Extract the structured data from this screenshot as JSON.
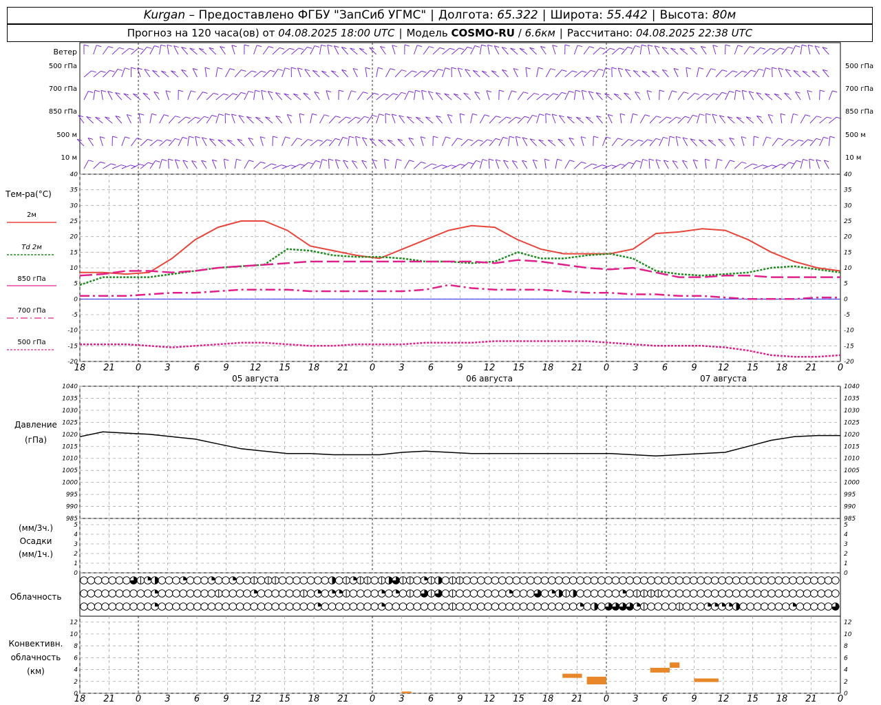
{
  "header": {
    "city": "Kurgan",
    "dash": "–",
    "provider": "Предоставлено ФГБУ \"ЗапСиб УГМС\"",
    "lon_label": "Долгота:",
    "lon": "65.322",
    "lat_label": "Широта:",
    "lat": "55.442",
    "alt_label": "Высота:",
    "alt": "80м",
    "forecast_label": "Прогноз на 120 часа(ов) от",
    "forecast_start": "04.08.2025 18:00 UTC",
    "model_label": "Модель",
    "model": "COSMO-RU",
    "model_res": "6.6км",
    "computed_label": "Рассчитано:",
    "computed": "04.08.2025 22:38 UTC"
  },
  "labels": {
    "wind": "Ветер",
    "wind_levels": [
      "500 гПа",
      "700 гПа",
      "850 гПа",
      "500 м",
      "10 м"
    ],
    "temp": "Тем-ра(°С)",
    "legend": [
      "2м",
      "Td 2м",
      "850 гПа",
      "700 гПа",
      "500 гПа"
    ],
    "pressure": [
      "Давление",
      "(гПа)"
    ],
    "precip": [
      "(мм/3ч.)",
      "Осадки",
      "(мм/1ч.)"
    ],
    "cloud": "Облачность",
    "conv": [
      "Конвективн.",
      "облачность",
      "(км)"
    ]
  },
  "colors": {
    "t2m": "#e8453a",
    "td": "#1e8c1e",
    "t850": "#e0208a",
    "t700": "#e0208a",
    "t500": "#e0208a",
    "wind": "#7b2fd0",
    "conv": "#e8862a",
    "zero": "#2424e0"
  },
  "time_ticks": [
    "18",
    "21",
    "0",
    "3",
    "6",
    "9",
    "12",
    "15",
    "18",
    "21",
    "0",
    "3",
    "6",
    "9",
    "12",
    "15",
    "18",
    "21",
    "0",
    "3",
    "6",
    "9",
    "12",
    "15",
    "18",
    "21",
    "0"
  ],
  "date_labels": [
    "05 августа",
    "06 августа",
    "07 августа"
  ],
  "chart_data": [
    {
      "type": "line",
      "ylabel": "Тем-ра(°С)",
      "ylim": [
        -20,
        40
      ],
      "y_ticks": [
        -20,
        -15,
        -10,
        -5,
        0,
        5,
        10,
        15,
        20,
        25,
        30,
        35,
        40
      ],
      "x_hours": [
        0,
        3,
        6,
        9,
        12,
        15,
        18,
        21,
        24,
        27,
        30,
        33,
        36,
        39,
        42,
        45,
        48,
        51,
        54,
        57,
        60,
        63,
        66,
        69,
        72,
        75,
        78
      ],
      "series": [
        {
          "name": "2м",
          "values": [
            8.5,
            8.5,
            8,
            8.5,
            13,
            19,
            23,
            25,
            25,
            22,
            17,
            15.5,
            14,
            13,
            16,
            19,
            22,
            23.5,
            23,
            19,
            16,
            14.5,
            14.5,
            14.5,
            16,
            21,
            21.5,
            22.5,
            22,
            19,
            15,
            12,
            10,
            9
          ]
        },
        {
          "name": "Td 2м",
          "values": [
            4.5,
            7,
            7,
            7,
            8,
            9,
            10,
            10.5,
            11,
            16,
            15.5,
            14,
            13.5,
            13.5,
            13,
            12,
            12,
            11.5,
            12,
            15,
            13,
            13,
            14,
            14.5,
            13,
            9,
            8,
            7.5,
            8,
            8.5,
            10,
            10.5,
            9.5,
            8.5
          ]
        },
        {
          "name": "850 гПа",
          "values": [
            7.5,
            8,
            9,
            9,
            8.5,
            9,
            10,
            10.5,
            11,
            11.5,
            12,
            12,
            12,
            12,
            12,
            12,
            12,
            12,
            11.5,
            12.5,
            12,
            11,
            10,
            9.5,
            10,
            8.5,
            7,
            7,
            7.5,
            7.5,
            7,
            7,
            7,
            7
          ]
        },
        {
          "name": "700 гПа",
          "values": [
            1,
            1,
            1,
            1.5,
            2,
            2,
            2.5,
            3,
            3,
            3,
            2.5,
            2.5,
            2.5,
            2.5,
            2.5,
            3,
            4.5,
            3.5,
            3,
            3,
            3,
            2.5,
            2,
            2,
            1.5,
            1.5,
            1,
            1,
            0.5,
            0,
            0,
            0,
            0.5,
            0.5
          ]
        },
        {
          "name": "500 гПа",
          "values": [
            -14.5,
            -14.5,
            -14.5,
            -15,
            -15.5,
            -15,
            -14.5,
            -14,
            -14,
            -14.5,
            -15,
            -15,
            -14.5,
            -14.5,
            -14.5,
            -14,
            -14,
            -14,
            -13.5,
            -13.5,
            -13.5,
            -13.5,
            -13.5,
            -14,
            -14.5,
            -15,
            -15,
            -15,
            -15.5,
            -16.5,
            -18,
            -18.5,
            -18.5,
            -18
          ]
        }
      ]
    },
    {
      "type": "line",
      "ylabel": "Давление (гПа)",
      "ylim": [
        985,
        1040
      ],
      "y_ticks": [
        985,
        990,
        995,
        1000,
        1005,
        1010,
        1015,
        1020,
        1025,
        1030,
        1035,
        1040
      ],
      "series": [
        {
          "name": "Давление",
          "values": [
            1019,
            1021,
            1020.5,
            1020,
            1019,
            1018,
            1016,
            1014,
            1013,
            1012,
            1012,
            1011.5,
            1011.5,
            1011.5,
            1012.5,
            1013,
            1012.5,
            1012,
            1012,
            1012,
            1012,
            1012,
            1012,
            1012,
            1011.5,
            1011,
            1011.5,
            1012,
            1012.5,
            1015,
            1017.5,
            1019,
            1019.5,
            1019.5
          ]
        }
      ]
    },
    {
      "type": "bar",
      "ylabel": "Осадки (мм/3ч.)",
      "ylim": [
        0,
        5
      ],
      "y_ticks": [
        0,
        1,
        2,
        3,
        4,
        5
      ],
      "values": []
    },
    {
      "type": "bar",
      "ylabel": "Конвективн. облачность (км)",
      "ylim": [
        0,
        13
      ],
      "y_ticks": [
        0,
        2,
        4,
        6,
        8,
        10,
        12
      ],
      "x_hours": [
        33,
        49.5,
        50,
        57,
        68,
        70,
        77
      ],
      "values": [
        {
          "hour_start": 33,
          "hour_end": 34,
          "bottom": 0,
          "top": 0.3
        },
        {
          "hour_start": 49.5,
          "hour_end": 51.5,
          "bottom": 2.6,
          "top": 3.3
        },
        {
          "hour_start": 52,
          "hour_end": 54,
          "bottom": 1.5,
          "top": 2.8
        },
        {
          "hour_start": 58.5,
          "hour_end": 60.5,
          "bottom": 3.5,
          "top": 4.3
        },
        {
          "hour_start": 60.5,
          "hour_end": 61.5,
          "bottom": 4.3,
          "top": 5.2
        },
        {
          "hour_start": 63,
          "hour_end": 65.5,
          "bottom": 1.9,
          "top": 2.5
        }
      ]
    }
  ],
  "clouds": {
    "rows": [
      "00000004123000200020020010110000000301211013411021301100000000000000000000000000000000000000000000000000000",
      "00000000002000000001000020000001020221000020201041401000000020004023130000002011110000000000000000000000000",
      "00000000002000000000000000000000020000000020000000001000000000000000002030444421000010002222300000002000004"
    ]
  }
}
